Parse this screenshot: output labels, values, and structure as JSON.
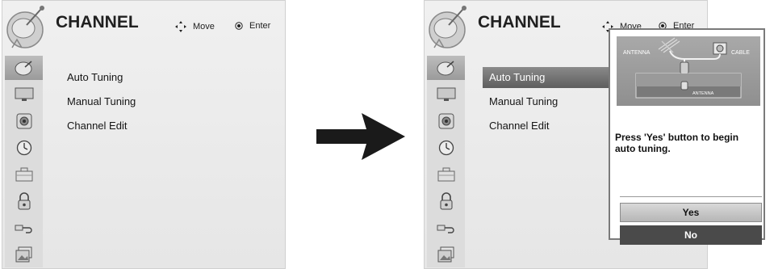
{
  "screens": [
    {
      "title": "CHANNEL",
      "help": {
        "move_label": "Move",
        "enter_label": "Enter"
      },
      "menu": [
        "Auto Tuning",
        "Manual Tuning",
        "Channel Edit"
      ],
      "selected_index": null,
      "sidebar_icons": [
        "satellite-icon",
        "monitor-icon",
        "speaker-icon",
        "clock-icon",
        "briefcase-icon",
        "lock-icon",
        "input-plug-icon",
        "picture-icon"
      ]
    },
    {
      "title": "CHANNEL",
      "help": {
        "move_label": "Move",
        "enter_label": "Enter"
      },
      "menu": [
        "Auto Tuning",
        "Manual Tuning",
        "Channel Edit"
      ],
      "selected_index": 0,
      "sidebar_icons": [
        "satellite-icon",
        "monitor-icon",
        "speaker-icon",
        "clock-icon",
        "briefcase-icon",
        "lock-icon",
        "input-plug-icon",
        "picture-icon"
      ],
      "dialog": {
        "illustration_labels": {
          "antenna": "ANTENNA",
          "cable": "CABLE",
          "input": "ANTENNA"
        },
        "message": "Press 'Yes' button to begin auto tuning.",
        "buttons": {
          "yes": "Yes",
          "no": "No"
        }
      }
    }
  ],
  "colors": {
    "selected_item": "#6f6f6f",
    "no_button": "#4a4a4a",
    "yes_button": "#c8c8c8"
  }
}
